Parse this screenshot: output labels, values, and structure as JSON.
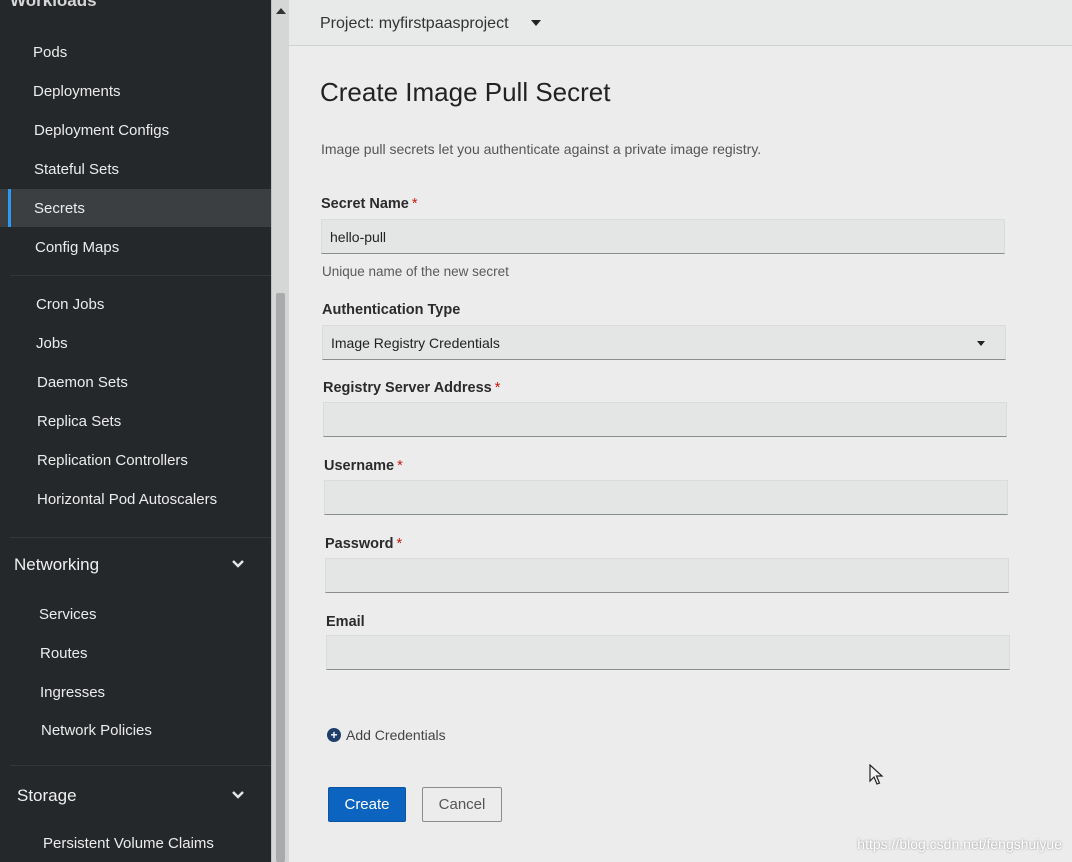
{
  "sidebar": {
    "cut_heading": "Workloads",
    "workloads": [
      {
        "label": "Pods"
      },
      {
        "label": "Deployments"
      },
      {
        "label": "Deployment Configs"
      },
      {
        "label": "Stateful Sets"
      },
      {
        "label": "Secrets",
        "active": true
      },
      {
        "label": "Config Maps"
      },
      {
        "label": "Cron Jobs"
      },
      {
        "label": "Jobs"
      },
      {
        "label": "Daemon Sets"
      },
      {
        "label": "Replica Sets"
      },
      {
        "label": "Replication Controllers"
      },
      {
        "label": "Horizontal Pod Autoscalers"
      }
    ],
    "networking": {
      "title": "Networking",
      "items": [
        {
          "label": "Services"
        },
        {
          "label": "Routes"
        },
        {
          "label": "Ingresses"
        },
        {
          "label": "Network Policies"
        }
      ]
    },
    "storage": {
      "title": "Storage",
      "items": [
        {
          "label": "Persistent Volume Claims"
        }
      ]
    },
    "chevron_icon": "chevron-down-icon"
  },
  "header": {
    "project_label": "Project: myfirstpaasproject"
  },
  "form": {
    "title": "Create Image Pull Secret",
    "description": "Image pull secrets let you authenticate against a private image registry.",
    "secret_name": {
      "label": "Secret Name",
      "required": "*",
      "value": "hello-pull",
      "help": "Unique name of the new secret"
    },
    "auth_type": {
      "label": "Authentication Type",
      "value": "Image Registry Credentials"
    },
    "registry_server": {
      "label": "Registry Server Address",
      "required": "*",
      "value": ""
    },
    "username": {
      "label": "Username",
      "required": "*",
      "value": ""
    },
    "password": {
      "label": "Password",
      "required": "*",
      "value": ""
    },
    "email": {
      "label": "Email",
      "value": ""
    },
    "add_credentials": "Add Credentials",
    "create_button": "Create",
    "cancel_button": "Cancel"
  },
  "watermark": "https://blog.csdn.net/fengshuiyue",
  "colors": {
    "sidebar_bg": "#25282b",
    "active_bar": "#2b9af3",
    "primary": "#0c64c0",
    "required": "#c9190b"
  }
}
